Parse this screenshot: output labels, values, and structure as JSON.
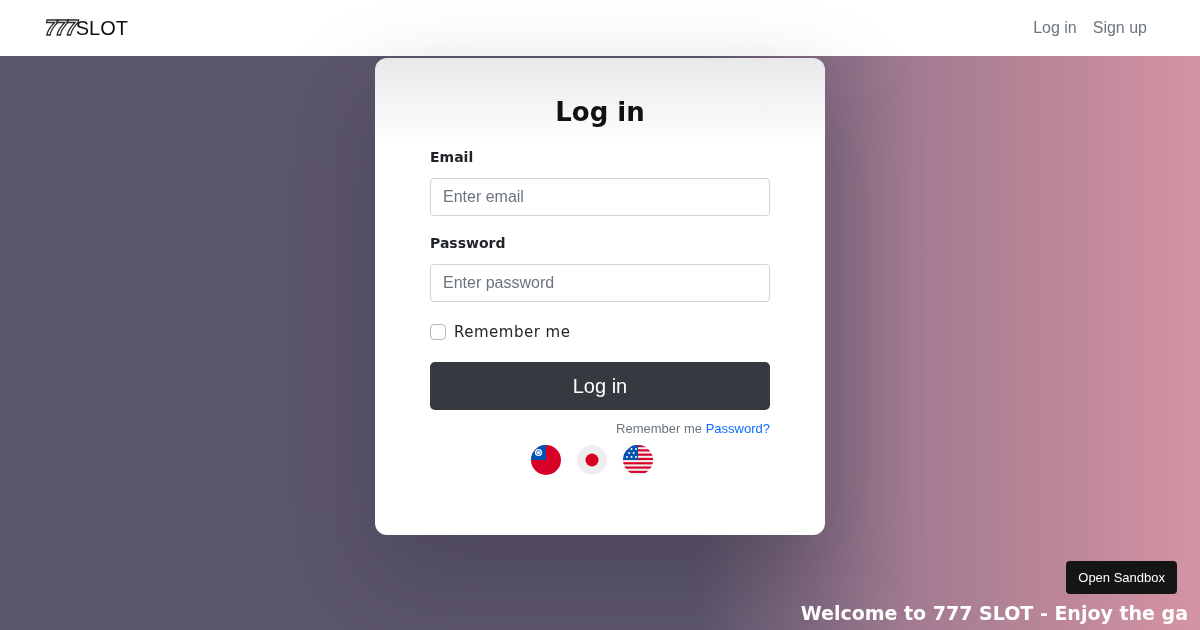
{
  "navbar": {
    "logo": {
      "digits": "777",
      "word": "SLOT"
    },
    "links": [
      {
        "label": "Log in"
      },
      {
        "label": "Sign up"
      }
    ]
  },
  "login_card": {
    "title": "Log in",
    "fields": [
      {
        "label": "Email",
        "placeholder": "Enter email"
      },
      {
        "label": "Password",
        "placeholder": "Enter password"
      }
    ],
    "remember": {
      "label": "Remember me",
      "checked": false
    },
    "submit": "Log in",
    "footer": {
      "text": "Remember me",
      "link": "Password?"
    },
    "languages": [
      {
        "kind": "tw"
      },
      {
        "kind": "jp"
      },
      {
        "kind": "us"
      }
    ]
  },
  "banner": {
    "text": "Welcome to 777 SLOT - Enjoy the ga"
  },
  "sandbox_button": {
    "label": "Open Sandbox"
  }
}
